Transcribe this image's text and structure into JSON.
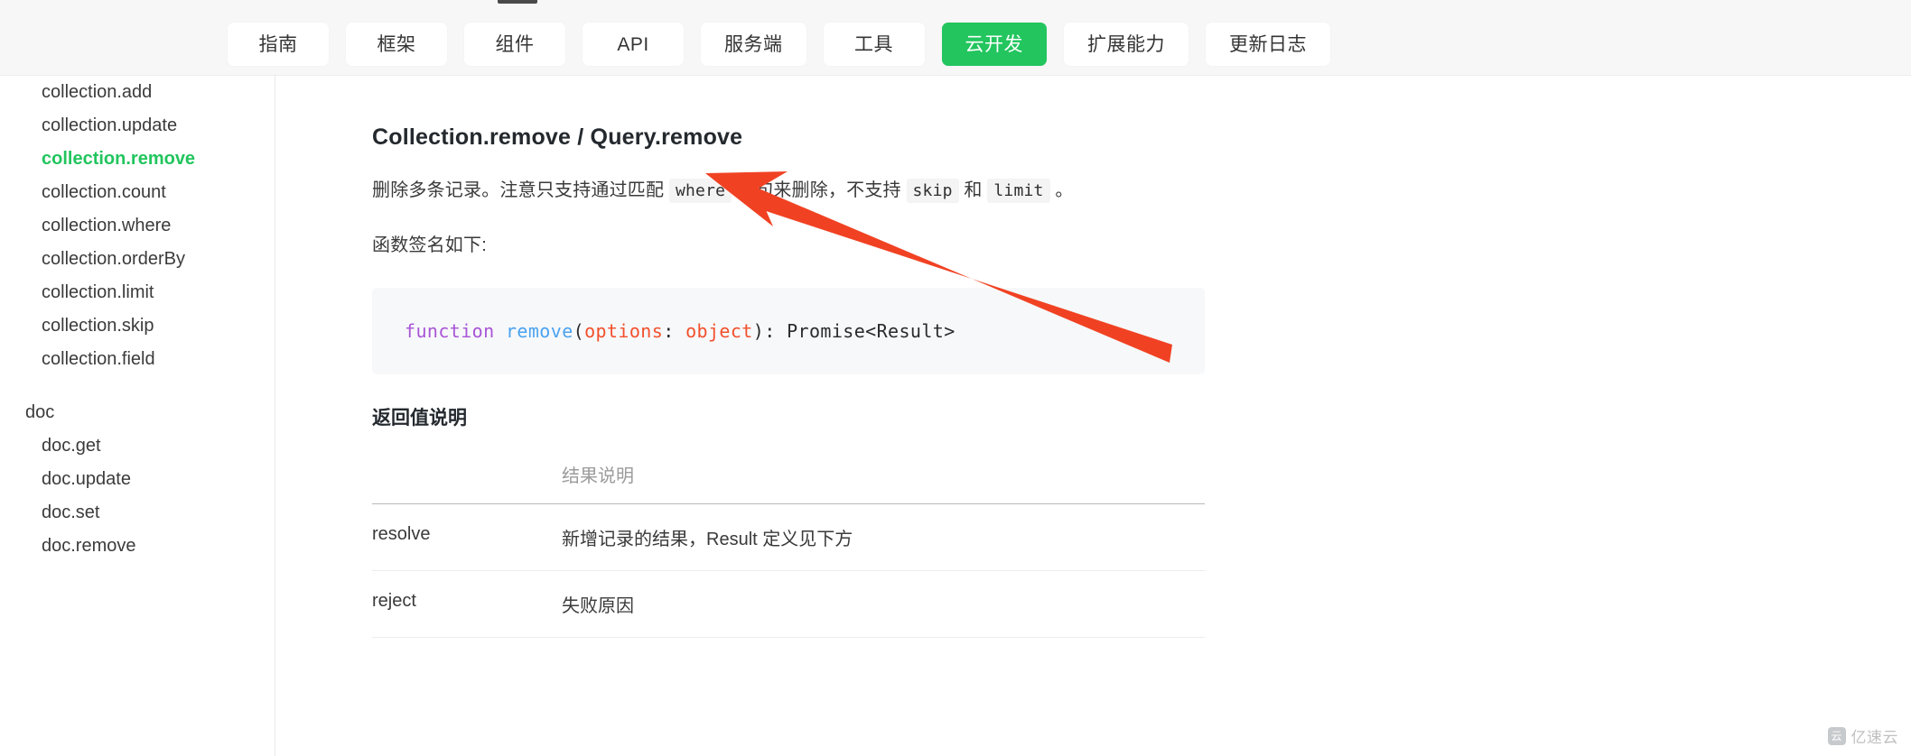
{
  "theme": {
    "accent_green": "#22c55e",
    "nav_bg": "#f7f7f7",
    "code_bg": "#f7f8fa",
    "arrow_color": "#f04223",
    "text_primary": "#3a3a3a",
    "muted": "#9b9b9b"
  },
  "topnav": {
    "tabs": [
      {
        "label": "指南",
        "active": false
      },
      {
        "label": "框架",
        "active": false
      },
      {
        "label": "组件",
        "active": false
      },
      {
        "label": "API",
        "active": false
      },
      {
        "label": "服务端",
        "active": false
      },
      {
        "label": "工具",
        "active": false
      },
      {
        "label": "云开发",
        "active": true
      },
      {
        "label": "扩展能力",
        "active": false
      },
      {
        "label": "更新日志",
        "active": false
      }
    ]
  },
  "sidebar": {
    "items": [
      {
        "label": "collection.add",
        "level": 2,
        "active": false
      },
      {
        "label": "collection.update",
        "level": 2,
        "active": false
      },
      {
        "label": "collection.remove",
        "level": 2,
        "active": true
      },
      {
        "label": "collection.count",
        "level": 2,
        "active": false
      },
      {
        "label": "collection.where",
        "level": 2,
        "active": false
      },
      {
        "label": "collection.orderBy",
        "level": 2,
        "active": false
      },
      {
        "label": "collection.limit",
        "level": 2,
        "active": false
      },
      {
        "label": "collection.skip",
        "level": 2,
        "active": false
      },
      {
        "label": "collection.field",
        "level": 2,
        "active": false
      },
      {
        "label": "doc",
        "level": 1,
        "active": false,
        "gap_before": true
      },
      {
        "label": "doc.get",
        "level": 2,
        "active": false
      },
      {
        "label": "doc.update",
        "level": 2,
        "active": false
      },
      {
        "label": "doc.set",
        "level": 2,
        "active": false
      },
      {
        "label": "doc.remove",
        "level": 2,
        "active": false
      }
    ]
  },
  "article": {
    "title": "Collection.remove / Query.remove",
    "description": {
      "seg1": "删除多条记录。注意只支持通过匹配",
      "code1": "where",
      "seg2": "语句来删除，不支持",
      "code2": "skip",
      "seg3": "和",
      "code3": "limit",
      "seg4": "。"
    },
    "signature_label": "函数签名如下:",
    "code": {
      "kw_function": "function",
      "fn_name": "remove",
      "paren_open": "(",
      "param_name": "options",
      "colon1": ": ",
      "param_type": "object",
      "paren_close": ")",
      "colon2": ": ",
      "return_type": "Promise<Result>"
    },
    "returns_heading": "返回值说明",
    "table": {
      "headers": [
        "",
        "结果说明"
      ],
      "rows": [
        {
          "name": "resolve",
          "desc": "新增记录的结果，Result 定义见下方"
        },
        {
          "name": "reject",
          "desc": "失败原因"
        }
      ]
    }
  },
  "annotation": {
    "arrow_name": "red-pointer-arrow",
    "points_to": "where"
  },
  "watermark": {
    "text": "亿速云",
    "mark": "云"
  }
}
